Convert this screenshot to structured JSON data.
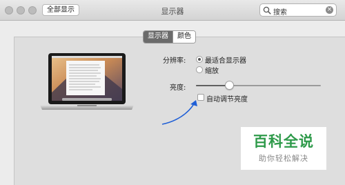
{
  "window": {
    "title": "显示器",
    "show_all_label": "全部显示"
  },
  "search": {
    "value": "搜索"
  },
  "tabs": [
    {
      "label": "显示器",
      "selected": true
    },
    {
      "label": "颜色",
      "selected": false
    }
  ],
  "resolution": {
    "label": "分辨率:",
    "options": [
      {
        "label": "最适合显示器",
        "selected": true
      },
      {
        "label": "缩放",
        "selected": false
      }
    ]
  },
  "brightness": {
    "label": "亮度:",
    "level": 0.27,
    "auto_label": "自动调节亮度",
    "auto_checked": false
  },
  "watermark": {
    "title": "百科全说",
    "subtitle": "助你轻松解决"
  },
  "colors": {
    "arrow": "#1f5fd6",
    "watermark_green": "#2e9a4a"
  }
}
